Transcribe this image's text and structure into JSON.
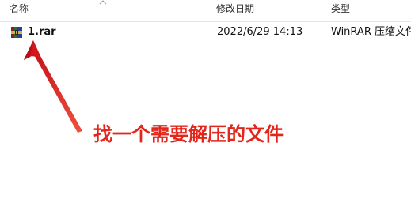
{
  "columns": {
    "name": "名称",
    "modified": "修改日期",
    "type": "类型"
  },
  "file": {
    "name": "1.rar",
    "modified": "2022/6/29 14:13",
    "type": "WinRAR 压缩文件",
    "icon": "winrar-archive-icon"
  },
  "annotation": {
    "text": "找一个需要解压的文件",
    "color": "#e3261c"
  }
}
